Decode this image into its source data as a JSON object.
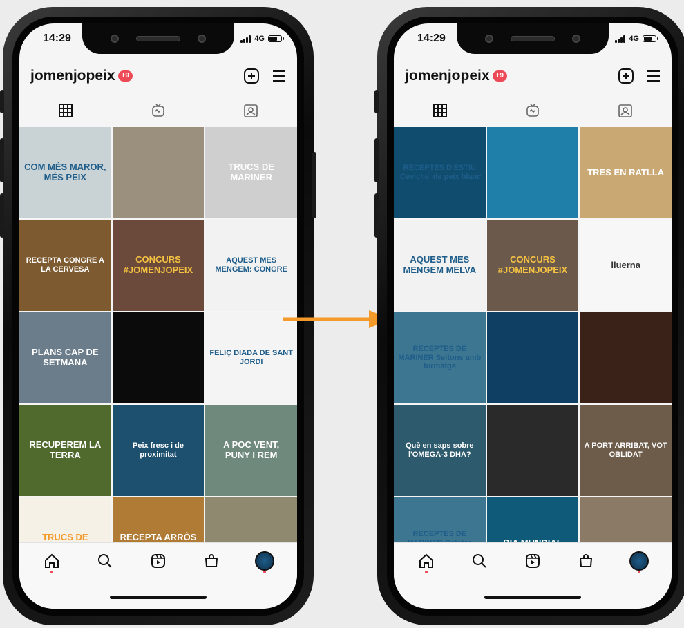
{
  "colors": {
    "badge": "#ed4956",
    "arrow": "#f39a2b",
    "accent_blue": "#1f5d8a"
  },
  "left_phone": {
    "status": {
      "time": "14:29",
      "network": "4G"
    },
    "header": {
      "username": "jomenjopeix",
      "badge": "+9"
    },
    "tiles": [
      {
        "label": "COM MÉS MAROR, MÉS PEIX",
        "bg": "#c9d3d6",
        "fg": "#1f5d8a"
      },
      {
        "label": "",
        "bg": "#9b8f7e",
        "fg": "#fff"
      },
      {
        "label": "TRUCS DE MARINER",
        "bg": "#cfcfcf",
        "fg": "#fff"
      },
      {
        "label": "RECEPTA CONGRE A LA CERVESA",
        "bg": "#7d5a2f",
        "fg": "#fff"
      },
      {
        "label": "CONCURS #JOMENJOPEIX",
        "bg": "#6b4a3b",
        "fg": "#f5c242"
      },
      {
        "label": "AQUEST MES MENGEM: CONGRE",
        "bg": "#f2f2f2",
        "fg": "#1f5d8a"
      },
      {
        "label": "PLANS CAP DE SETMANA",
        "bg": "#6b7c8b",
        "fg": "#fff"
      },
      {
        "label": "",
        "bg": "#0b0b0b",
        "fg": "#fff"
      },
      {
        "label": "FELIÇ DIADA DE SANT JORDI",
        "bg": "#f4f4f4",
        "fg": "#1f5d8a"
      },
      {
        "label": "RECUPEREM LA TERRA",
        "bg": "#506a2e",
        "fg": "#fff"
      },
      {
        "label": "Peix fresc i de proximitat",
        "bg": "#1d4f6e",
        "fg": "#fff"
      },
      {
        "label": "A POC VENT, PUNY I REM",
        "bg": "#6f8a7c",
        "fg": "#fff"
      },
      {
        "label": "TRUCS DE MARINER",
        "bg": "#f6f1e6",
        "fg": "#f39a2b"
      },
      {
        "label": "RECEPTA ARRÒS AMB POP",
        "bg": "#b07b35",
        "fg": "#fff"
      },
      {
        "label": "",
        "bg": "#8f8a6f",
        "fg": "#fff"
      }
    ],
    "nav": [
      "home-icon",
      "search-icon",
      "reels-icon",
      "shop-icon",
      "profile-avatar"
    ]
  },
  "right_phone": {
    "status": {
      "time": "14:29",
      "network": "4G"
    },
    "header": {
      "username": "jomenjopeix",
      "badge": "+9"
    },
    "tiles": [
      {
        "label": "RECEPTES D'ESTIU 'Ceviche' de peix blanc",
        "bg": "#0f4c6e",
        "fg": "#1f5d8a"
      },
      {
        "label": "",
        "bg": "#1f7fa8",
        "fg": "#fff"
      },
      {
        "label": "TRES EN RATLLA",
        "bg": "#c9a874",
        "fg": "#fff"
      },
      {
        "label": "AQUEST MES MENGEM MELVA",
        "bg": "#f2f2f2",
        "fg": "#1f5d8a"
      },
      {
        "label": "CONCURS #JOMENJOPEIX",
        "bg": "#6b5a4b",
        "fg": "#f5c242"
      },
      {
        "label": "lluerna",
        "bg": "#f7f7f7",
        "fg": "#333"
      },
      {
        "label": "RECEPTES DE MARINER Seitons amb formatge",
        "bg": "#3d7690",
        "fg": "#1f5d8a"
      },
      {
        "label": "",
        "bg": "#0f3f63",
        "fg": "#fff"
      },
      {
        "label": "",
        "bg": "#3a2218",
        "fg": "#fff"
      },
      {
        "label": "Què en saps sobre l'OMEGA-3 DHA?",
        "bg": "#2e5a6e",
        "fg": "#fff"
      },
      {
        "label": "",
        "bg": "#2a2a2a",
        "fg": "#fff"
      },
      {
        "label": "A PORT ARRIBAT, VOT OBLIDAT",
        "bg": "#6e5c4a",
        "fg": "#fff"
      },
      {
        "label": "RECEPTES DE MARINER Galetes d'anxova",
        "bg": "#3d7690",
        "fg": "#1f5d8a"
      },
      {
        "label": "DIA MUNDIAL",
        "bg": "#0e5a78",
        "fg": "#fff"
      },
      {
        "label": "",
        "bg": "#8a7a66",
        "fg": "#fff"
      }
    ],
    "nav": [
      "home-icon",
      "search-icon",
      "reels-icon",
      "shop-icon",
      "profile-avatar"
    ]
  }
}
